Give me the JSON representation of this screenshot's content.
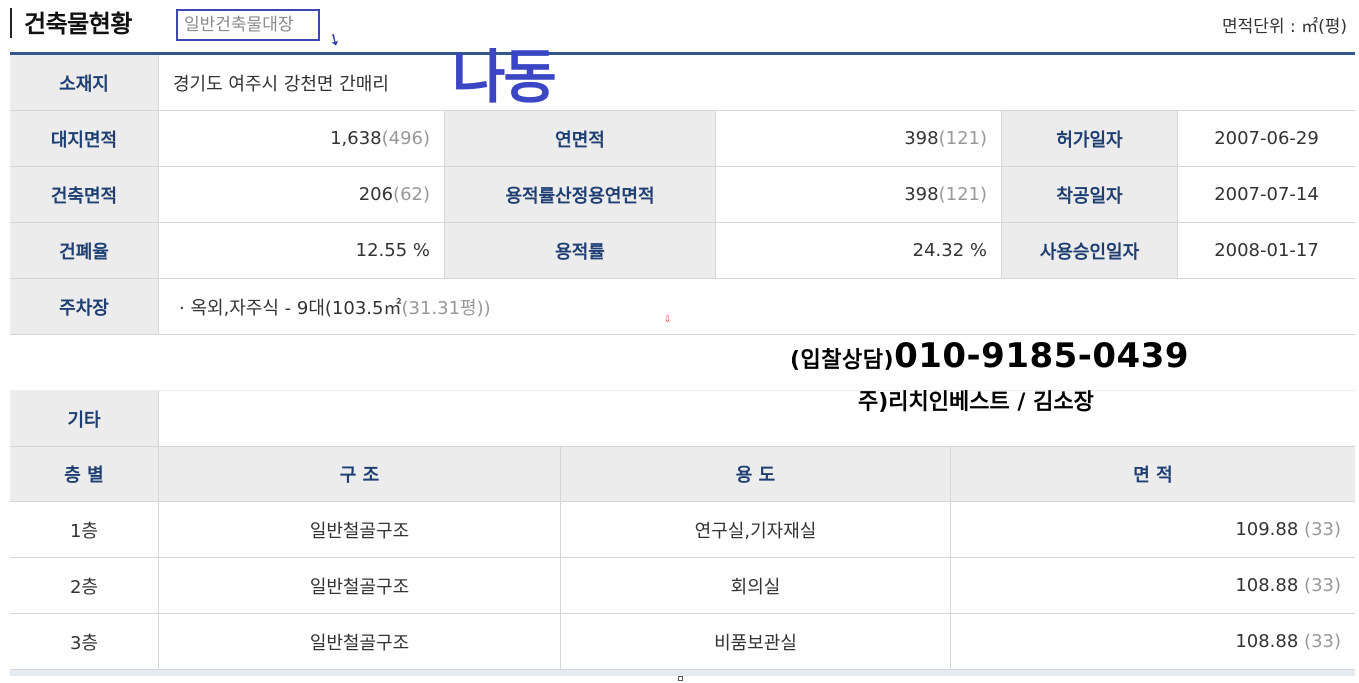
{
  "header": {
    "title": "건축물현황",
    "subtitle": "일반건축물대장",
    "unit": "면적단위 : ㎡(평)",
    "stamp": "나동"
  },
  "info": {
    "location_label": "소재지",
    "location_value": "경기도 여주시 강천면 간매리",
    "land_area_label": "대지면적",
    "land_area_value": "1,638",
    "land_area_pyeong": "(496)",
    "total_floor_area_label": "연면적",
    "total_floor_area_value": "398",
    "total_floor_area_pyeong": "(121)",
    "permit_date_label": "허가일자",
    "permit_date_value": "2007-06-29",
    "building_area_label": "건축면적",
    "building_area_value": "206",
    "building_area_pyeong": "(62)",
    "far_floor_area_label": "용적률산정용연면적",
    "far_floor_area_value": "398",
    "far_floor_area_pyeong": "(121)",
    "construction_start_label": "착공일자",
    "construction_start_value": "2007-07-14",
    "coverage_ratio_label": "건폐율",
    "coverage_ratio_value": "12.55 %",
    "far_label": "용적률",
    "far_value": "24.32 %",
    "approval_date_label": "사용승인일자",
    "approval_date_value": "2008-01-17",
    "parking_label": "주차장",
    "parking_value": "· 옥외,자주식 - 9대(103.5㎡ ",
    "parking_pyeong": "(31.31평))",
    "etc_label": "기타"
  },
  "promo": {
    "phone_label": "(입찰상담)",
    "phone": "010-9185-0439",
    "company": "주)리치인베스트 / 김소장"
  },
  "floors": {
    "headers": [
      "층 별",
      "구  조",
      "용  도",
      "면 적"
    ],
    "rows": [
      {
        "floor": "1층",
        "structure": "일반철골구조",
        "use": "연구실,기자재실",
        "area": "109.88",
        "pyeong": "(33)"
      },
      {
        "floor": "2층",
        "structure": "일반철골구조",
        "use": "회의실",
        "area": "108.88",
        "pyeong": "(33)"
      },
      {
        "floor": "3층",
        "structure": "일반철골구조",
        "use": "비품보관실",
        "area": "108.88",
        "pyeong": "(33)"
      }
    ]
  }
}
